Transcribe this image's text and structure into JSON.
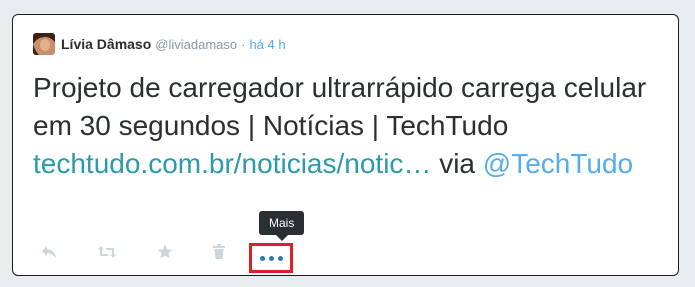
{
  "tweet": {
    "author_name": "Lívia Dâmaso",
    "author_handle": "@liviadamaso",
    "separator": "·",
    "timestamp": "há 4 h",
    "text_main": "Projeto de carregador ultrarrápido carrega celular em 30 segundos | Notícias | TechTudo ",
    "link_text": "techtudo.com.br/noticias/notic…",
    "via_text": " via ",
    "mention_text": "@TechTudo"
  },
  "actions": {
    "reply_icon": "reply-icon",
    "retweet_icon": "retweet-icon",
    "favorite_icon": "star-icon",
    "delete_icon": "trash-icon",
    "more_icon": "more-dots-icon"
  },
  "tooltip": {
    "label": "Mais"
  },
  "colors": {
    "link": "#2b9bab",
    "mention": "#55acee",
    "time": "#55acee",
    "highlight": "#e01e26",
    "tooltip_bg": "#292f33"
  }
}
